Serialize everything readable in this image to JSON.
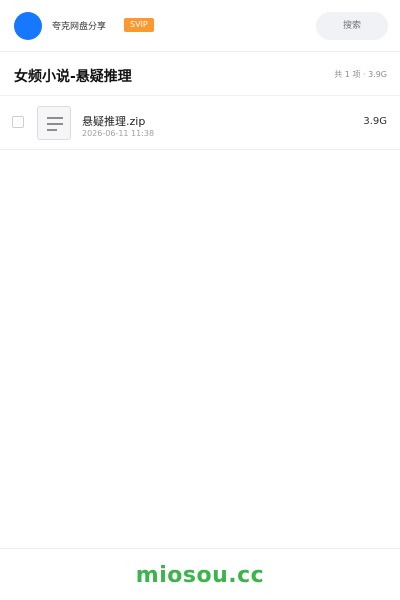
{
  "topbar": {
    "app_name": "夸克网盘分享",
    "badge": "SVIP",
    "search_placeholder": "搜索",
    "avatar_color": "#1677ff",
    "badge_color": "#fa9a2e"
  },
  "folder": {
    "title": "女频小说-悬疑推理",
    "summary": "共 1 项 · 3.9G"
  },
  "files": [
    {
      "name": "悬疑推理.zip",
      "date": "2026-06-11 11:38",
      "size": "3.9G",
      "icon": "file-list-icon",
      "checked": false
    }
  ],
  "footer": {
    "watermark": "miosou.cc",
    "watermark_color": "#3cb44b"
  }
}
